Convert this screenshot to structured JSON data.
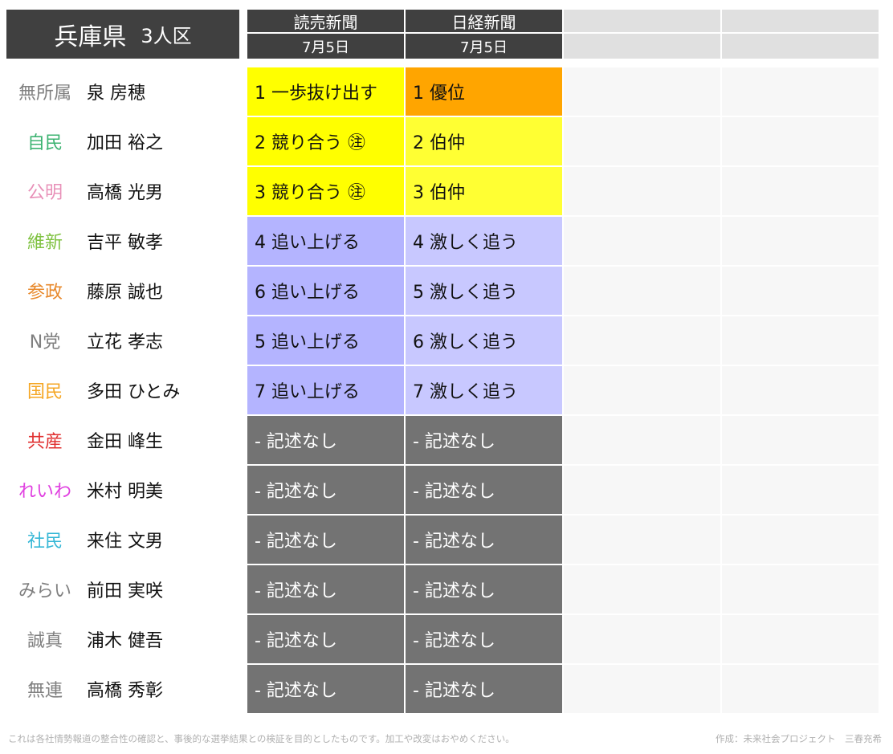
{
  "header": {
    "title": "兵庫県",
    "subtitle": "3人区",
    "columns": [
      {
        "name": "読売新聞",
        "date": "7月5日"
      },
      {
        "name": "日経新聞",
        "date": "7月5日"
      },
      {
        "name": "",
        "date": ""
      },
      {
        "name": "",
        "date": ""
      }
    ]
  },
  "colors": {
    "header_bg": "#404040",
    "orange": "#ffa500",
    "yellow": "#ffff00",
    "blue_dark": "#b4b4ff",
    "blue_light": "#c8c8ff",
    "gray": "#737373"
  },
  "rows": [
    {
      "party": "無所属",
      "party_color": "#808080",
      "candidate": "泉 房穂",
      "cells": [
        {
          "text": "1 一歩抜け出す",
          "bg": "#ffff00"
        },
        {
          "text": "1 優位",
          "bg": "#ffa500"
        }
      ]
    },
    {
      "party": "自民",
      "party_color": "#3cb371",
      "candidate": "加田 裕之",
      "cells": [
        {
          "text": "2 競り合う ㊟",
          "bg": "#ffff00"
        },
        {
          "text": "2 伯仲",
          "bg": "#ffff33"
        }
      ]
    },
    {
      "party": "公明",
      "party_color": "#e890b8",
      "candidate": "高橋 光男",
      "cells": [
        {
          "text": "3 競り合う ㊟",
          "bg": "#ffff00"
        },
        {
          "text": "3 伯仲",
          "bg": "#ffff33"
        }
      ]
    },
    {
      "party": "維新",
      "party_color": "#7fc241",
      "candidate": "吉平 敏孝",
      "cells": [
        {
          "text": "4 追い上げる",
          "bg": "#b4b4ff"
        },
        {
          "text": "4 激しく追う",
          "bg": "#c8c8ff"
        }
      ]
    },
    {
      "party": "参政",
      "party_color": "#e8892c",
      "candidate": "藤原 誠也",
      "cells": [
        {
          "text": "6 追い上げる",
          "bg": "#b4b4ff"
        },
        {
          "text": "5 激しく追う",
          "bg": "#c8c8ff"
        }
      ]
    },
    {
      "party": "N党",
      "party_color": "#808080",
      "candidate": "立花 孝志",
      "cells": [
        {
          "text": "5 追い上げる",
          "bg": "#b4b4ff"
        },
        {
          "text": "6 激しく追う",
          "bg": "#c8c8ff"
        }
      ]
    },
    {
      "party": "国民",
      "party_color": "#f5a623",
      "candidate": "多田 ひとみ",
      "cells": [
        {
          "text": "7 追い上げる",
          "bg": "#b4b4ff"
        },
        {
          "text": "7 激しく追う",
          "bg": "#c8c8ff"
        }
      ]
    },
    {
      "party": "共産",
      "party_color": "#e03030",
      "candidate": "金田 峰生",
      "cells": [
        {
          "text": "- 記述なし",
          "bg": "#737373"
        },
        {
          "text": "- 記述なし",
          "bg": "#737373"
        }
      ]
    },
    {
      "party": "れいわ",
      "party_color": "#e040e0",
      "candidate": "米村 明美",
      "cells": [
        {
          "text": "- 記述なし",
          "bg": "#737373"
        },
        {
          "text": "- 記述なし",
          "bg": "#737373"
        }
      ]
    },
    {
      "party": "社民",
      "party_color": "#35b7d6",
      "candidate": "来住 文男",
      "cells": [
        {
          "text": "- 記述なし",
          "bg": "#737373"
        },
        {
          "text": "- 記述なし",
          "bg": "#737373"
        }
      ]
    },
    {
      "party": "みらい",
      "party_color": "#808080",
      "candidate": "前田 実咲",
      "cells": [
        {
          "text": "- 記述なし",
          "bg": "#737373"
        },
        {
          "text": "- 記述なし",
          "bg": "#737373"
        }
      ]
    },
    {
      "party": "誠真",
      "party_color": "#808080",
      "candidate": "浦木 健吾",
      "cells": [
        {
          "text": "- 記述なし",
          "bg": "#737373"
        },
        {
          "text": "- 記述なし",
          "bg": "#737373"
        }
      ]
    },
    {
      "party": "無連",
      "party_color": "#808080",
      "candidate": "高橋 秀彰",
      "cells": [
        {
          "text": "- 記述なし",
          "bg": "#737373"
        },
        {
          "text": "- 記述なし",
          "bg": "#737373"
        }
      ]
    }
  ],
  "footer": {
    "note": "これは各社情勢報道の整合性の確認と、事後的な選挙結果との検証を目的としたものです。加工や改変はおやめください。",
    "credit": "作成：未来社会プロジェクト　三春充希"
  }
}
